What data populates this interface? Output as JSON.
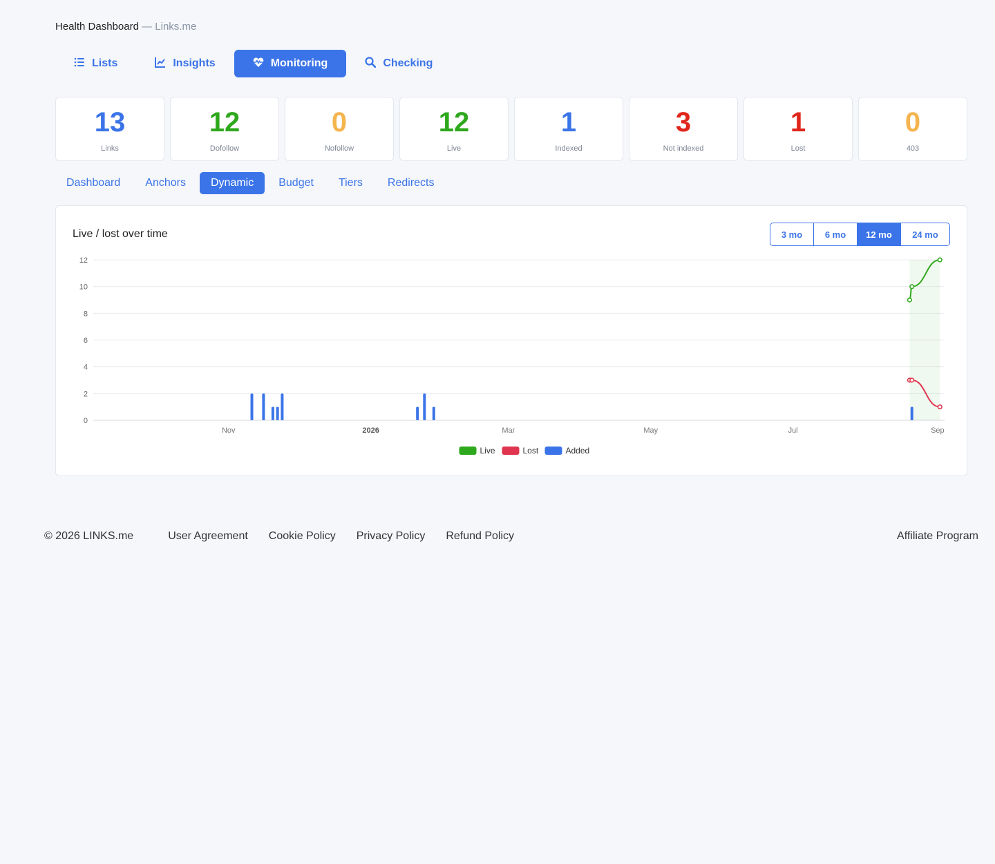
{
  "header": {
    "title": "Health Dashboard",
    "separator": "—",
    "site": "Links.me"
  },
  "main_nav": [
    {
      "label": "Lists",
      "icon": "list-icon",
      "active": false
    },
    {
      "label": "Insights",
      "icon": "chart-line-icon",
      "active": false
    },
    {
      "label": "Monitoring",
      "icon": "heartbeat-icon",
      "active": true
    },
    {
      "label": "Checking",
      "icon": "search-icon",
      "active": false
    }
  ],
  "stats": [
    {
      "value": "13",
      "label": "Links",
      "color": "#3b74e8"
    },
    {
      "value": "12",
      "label": "Dofollow",
      "color": "#2ea81c"
    },
    {
      "value": "0",
      "label": "Nofollow",
      "color": "#f4b44e"
    },
    {
      "value": "12",
      "label": "Live",
      "color": "#2ea81c"
    },
    {
      "value": "1",
      "label": "Indexed",
      "color": "#3b74e8"
    },
    {
      "value": "3",
      "label": "Not indexed",
      "color": "#e0251b"
    },
    {
      "value": "1",
      "label": "Lost",
      "color": "#e0251b"
    },
    {
      "value": "0",
      "label": "403",
      "color": "#f4b44e"
    }
  ],
  "sub_tabs": [
    {
      "label": "Dashboard",
      "active": false
    },
    {
      "label": "Anchors",
      "active": false
    },
    {
      "label": "Dynamic",
      "active": true
    },
    {
      "label": "Budget",
      "active": false
    },
    {
      "label": "Tiers",
      "active": false
    },
    {
      "label": "Redirects",
      "active": false
    }
  ],
  "panel": {
    "title": "Live / lost over time",
    "ranges": [
      {
        "label": "3 mo",
        "active": false
      },
      {
        "label": "6 mo",
        "active": false
      },
      {
        "label": "12 mo",
        "active": true
      },
      {
        "label": "24 mo",
        "active": false
      }
    ]
  },
  "chart_data": {
    "type": "bar",
    "title": "Live / lost over time",
    "xlabel": "",
    "ylabel": "",
    "ylim": [
      0,
      12
    ],
    "yticks": [
      0,
      2,
      4,
      6,
      8,
      10,
      12
    ],
    "xlim": [
      "2025-09-04",
      "2026-09-04"
    ],
    "xticks": [
      {
        "date": "2025-11-01",
        "label": "Nov",
        "bold": false
      },
      {
        "date": "2026-01-01",
        "label": "2026",
        "bold": true
      },
      {
        "date": "2026-03-01",
        "label": "Mar",
        "bold": false
      },
      {
        "date": "2026-05-01",
        "label": "May",
        "bold": false
      },
      {
        "date": "2026-07-01",
        "label": "Jul",
        "bold": false
      },
      {
        "date": "2026-09-01",
        "label": "Sep",
        "bold": false
      }
    ],
    "grid": true,
    "legend": "bottom",
    "series": [
      {
        "name": "Live",
        "type": "line",
        "color": "#2ea81c",
        "points": [
          {
            "x": "2026-08-20",
            "y": 9
          },
          {
            "x": "2026-08-21",
            "y": 10
          },
          {
            "x": "2026-09-02",
            "y": 12
          }
        ]
      },
      {
        "name": "Lost",
        "type": "line",
        "color": "#e0354f",
        "points": [
          {
            "x": "2026-08-20",
            "y": 3
          },
          {
            "x": "2026-08-21",
            "y": 3
          },
          {
            "x": "2026-09-02",
            "y": 1
          }
        ]
      },
      {
        "name": "Added",
        "type": "bar",
        "color": "#3b74e8",
        "points": [
          {
            "x": "2025-11-11",
            "y": 2
          },
          {
            "x": "2025-11-16",
            "y": 2
          },
          {
            "x": "2025-11-20",
            "y": 1
          },
          {
            "x": "2025-11-22",
            "y": 1
          },
          {
            "x": "2025-11-24",
            "y": 2
          },
          {
            "x": "2026-01-21",
            "y": 1
          },
          {
            "x": "2026-01-24",
            "y": 2
          },
          {
            "x": "2026-01-28",
            "y": 1
          },
          {
            "x": "2026-08-21",
            "y": 1
          }
        ]
      }
    ],
    "highlight_range": [
      "2026-08-20",
      "2026-09-02"
    ]
  },
  "footer": {
    "copyright": "© 2026 LINKS.me",
    "links": [
      "User Agreement",
      "Cookie Policy",
      "Privacy Policy",
      "Refund Policy"
    ],
    "affiliate": "Affiliate Program"
  }
}
